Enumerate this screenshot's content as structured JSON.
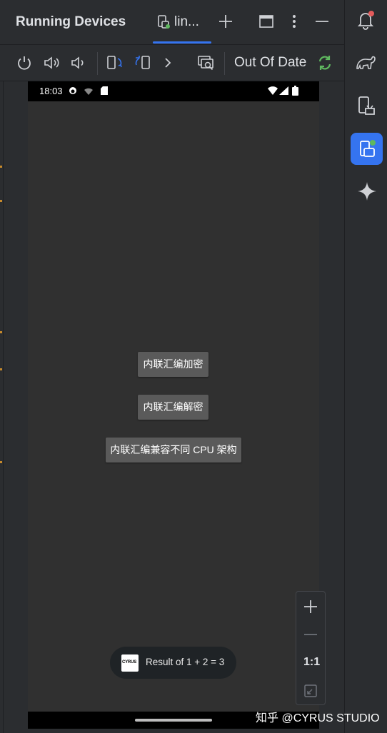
{
  "panel": {
    "title": "Running Devices",
    "tab_label": "lin...",
    "colors": {
      "accent": "#3574f0",
      "sync_green": "#5fb85f",
      "notif_red": "#e55b5b"
    }
  },
  "toolbar": {
    "status_text": "Out Of Date",
    "icons": [
      "power-icon",
      "volume-up-icon",
      "volume-down-icon",
      "rotate-left-icon",
      "rotate-right-icon",
      "chevron-right-icon",
      "screen-record-icon",
      "sync-icon"
    ]
  },
  "device": {
    "time": "18:03",
    "buttons": {
      "encrypt": "内联汇编加密",
      "decrypt": "内联汇编解密",
      "compat": "内联汇编兼容不同 CPU 架构"
    },
    "toast": {
      "logo_text": "CYRUS",
      "message": "Result of 1 + 2 = 3"
    }
  },
  "zoom": {
    "actual_size_label": "1:1"
  },
  "right_strip": {
    "icons": [
      "notifications-icon",
      "gradle-elephant-icon",
      "device-manager-icon",
      "running-devices-icon",
      "gemini-sparkle-icon"
    ]
  },
  "watermark": "知乎 @CYRUS STUDIO"
}
